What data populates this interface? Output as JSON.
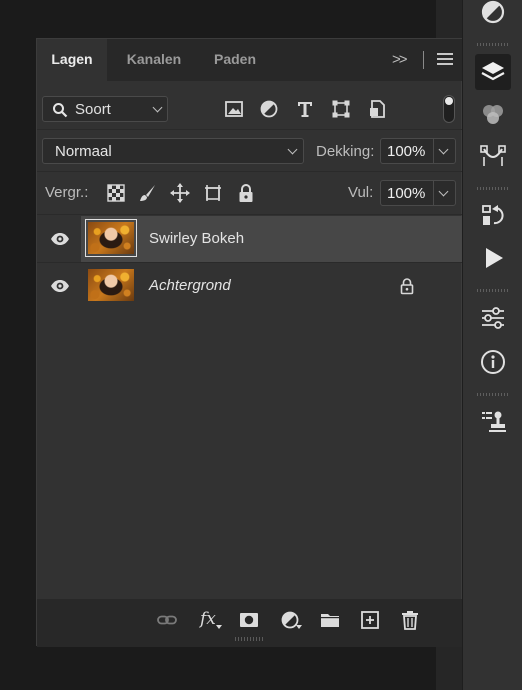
{
  "tabs": [
    {
      "label": "Lagen",
      "active": true
    },
    {
      "label": "Kanalen",
      "active": false
    },
    {
      "label": "Paden",
      "active": false
    }
  ],
  "tabs_more": ">>",
  "filter": {
    "kind_label": "Soort",
    "kind_icons": [
      "image-filter-icon",
      "adjustment-filter-icon",
      "type-filter-icon",
      "shape-filter-icon",
      "smart-object-filter-icon"
    ]
  },
  "blend": {
    "mode": "Normaal",
    "opacity_label": "Dekking:",
    "opacity_value": "100%"
  },
  "lock": {
    "label": "Vergr.:",
    "fill_label": "Vul:",
    "fill_value": "100%"
  },
  "layers": [
    {
      "name": "Swirley Bokeh",
      "visible": true,
      "selected": true,
      "locked": false,
      "italic": false
    },
    {
      "name": "Achtergrond",
      "visible": true,
      "selected": false,
      "locked": true,
      "italic": true
    }
  ],
  "footer_icons": [
    "link-layers-icon",
    "fx-icon",
    "mask-icon",
    "adjustment-layer-icon",
    "folder-icon",
    "new-layer-icon",
    "trash-icon"
  ],
  "footer_fx_label": "fx",
  "colors": {
    "panel": "#323232",
    "tabbar": "#282828",
    "selected_row": "#474747",
    "text": "#e4e4e4"
  }
}
